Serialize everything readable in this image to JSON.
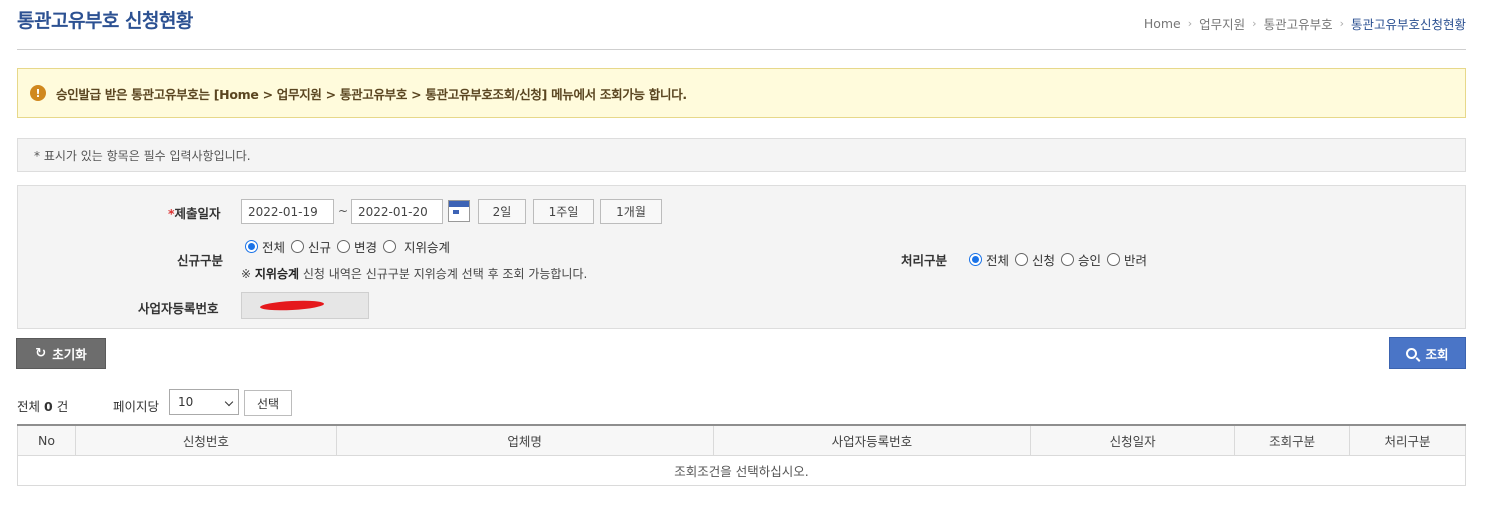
{
  "header": {
    "title": "통관고유부호 신청현황",
    "breadcrumb": [
      "Home",
      "업무지원",
      "통관고유부호",
      "통관고유부호신청현황"
    ]
  },
  "notice": {
    "text": "승인발급 받은 통관고유부호는 [Home > 업무지원 > 통관고유부호 > 통관고유부호조회/신청] 메뉴에서 조회가능 합니다."
  },
  "required_note": "* 표시가 있는 항목은 필수 입력사항입니다.",
  "search": {
    "date_label_star": "*",
    "date_label": "제출일자",
    "date_from": "2022-01-19",
    "date_to": "2022-01-20",
    "tilde": "~",
    "period_buttons": [
      "2일",
      "1주일",
      "1개월"
    ],
    "new_type_label": "신규구분",
    "new_type_options": [
      "전체",
      "신규",
      "변경",
      "지위승계"
    ],
    "new_type_selected": "전체",
    "hint_prefix": "※",
    "hint_bold": "지위승계",
    "hint_text": "신청 내역은 신규구분 지위승계 선택 후 조회 가능합니다.",
    "process_label": "처리구분",
    "process_options": [
      "전체",
      "신청",
      "승인",
      "반려"
    ],
    "process_selected": "전체",
    "biz_label": "사업자등록번호"
  },
  "actions": {
    "reset_label": "초기화",
    "search_label": "조회"
  },
  "list": {
    "total_prefix": "전체",
    "total_count": "0",
    "total_suffix": "건",
    "per_page_label": "페이지당",
    "per_page_value": "10",
    "select_label": "선택",
    "columns": [
      "No",
      "신청번호",
      "업체명",
      "사업자등록번호",
      "신청일자",
      "조회구분",
      "처리구분"
    ],
    "empty_message": "조회조건을 선택하십시오."
  },
  "colors": {
    "title": "#2c5192",
    "notice_bg": "#fffbdc",
    "search_button": "#4a75c7",
    "reset_button": "#6d6d6d",
    "radio_checked": "#1a73e8"
  }
}
